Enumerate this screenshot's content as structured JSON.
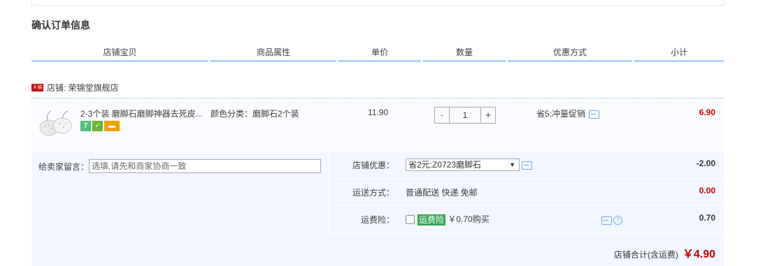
{
  "title": "确认订单信息",
  "columns": [
    "店铺宝贝",
    "商品属性",
    "单价",
    "数量",
    "优惠方式",
    "小计"
  ],
  "shop": {
    "badge": "天猫",
    "label": "店铺: 荣锦堂旗舰店"
  },
  "item": {
    "title": "2-3个装 磨脚石磨脚神器去死皮...",
    "badges": [
      "7",
      "✓",
      "▬"
    ],
    "attribute": "颜色分类：磨脚石2个装",
    "unit_price": "11.90",
    "quantity": {
      "minus": "-",
      "value": "1",
      "plus": "+"
    },
    "promo": "省5:冲量促销",
    "subtotal": "6.90"
  },
  "message": {
    "label": "给卖家留言：",
    "placeholder": "选填,请先和商家协商一致"
  },
  "shop_discount": {
    "label": "店铺优惠：",
    "selected": "省2元:Z0723磨脚石",
    "arrow": "▼",
    "amount": "-2.00"
  },
  "shipping": {
    "label": "运送方式：",
    "value": "普通配送 快递 免邮",
    "amount": "0.00"
  },
  "insurance": {
    "label": "运费险：",
    "tag": "运费险",
    "text": "￥0.70购买",
    "help": "?",
    "amount": "0.70"
  },
  "total": {
    "label": "店铺合计(含运费)",
    "value": "￥4.90"
  },
  "colors": {
    "accent_red": "#c40000",
    "header_underline": "#b2d1ff",
    "panel_bg": "#f2f7ff"
  }
}
